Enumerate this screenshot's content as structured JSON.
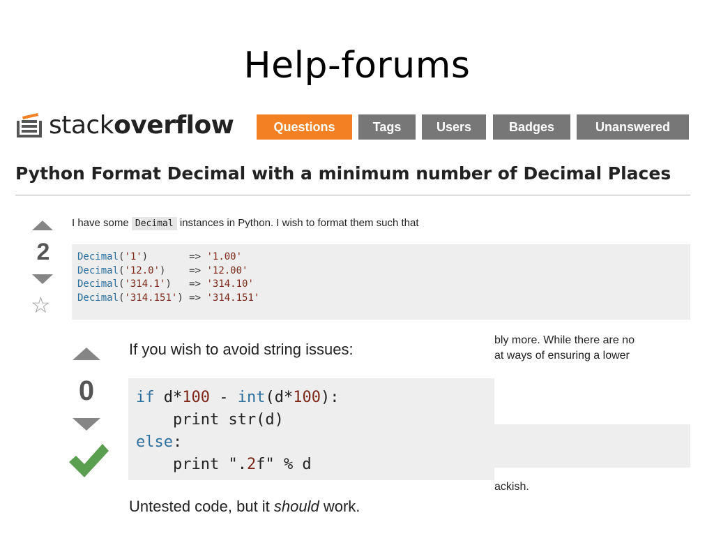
{
  "slide_title": "Help-forums",
  "header": {
    "logo_light": "stack",
    "logo_bold": "overflow",
    "nav": [
      "Questions",
      "Tags",
      "Users",
      "Badges",
      "Unanswered"
    ],
    "active": "Questions"
  },
  "question": {
    "title": "Python Format Decimal with a minimum number of Decimal Places",
    "votes": "2",
    "text_before": "I have some",
    "inline_code": "Decimal",
    "text_after": "instances in Python. I wish to format them such that",
    "code_lines": [
      {
        "fn": "Decimal",
        "arg": "'1'",
        "pad": "      ",
        "result": "'1.00'"
      },
      {
        "fn": "Decimal",
        "arg": "'12.0'",
        "pad": "   ",
        "result": "'12.00'"
      },
      {
        "fn": "Decimal",
        "arg": "'314.1'",
        "pad": "  ",
        "result": "'314.10'"
      },
      {
        "fn": "Decimal",
        "arg": "'314.151'",
        "pad": "",
        "result": "'314.151'"
      }
    ],
    "partial_line1": "bly more. While there are no",
    "partial_line2": "at ways of ensuring a lower",
    "partial_line3": "ackish."
  },
  "answer": {
    "votes": "0",
    "intro": "If you wish to avoid string issues:",
    "code": "if d*100 - int(d*100):\n    print str(d)\nelse:\n    print \".2f\" % d",
    "footer_before": "Untested code, but it ",
    "footer_em": "should",
    "footer_after": " work."
  },
  "colors": {
    "active_tab": "#f48024",
    "tab": "#777777",
    "accepted": "#5a9e4f"
  }
}
